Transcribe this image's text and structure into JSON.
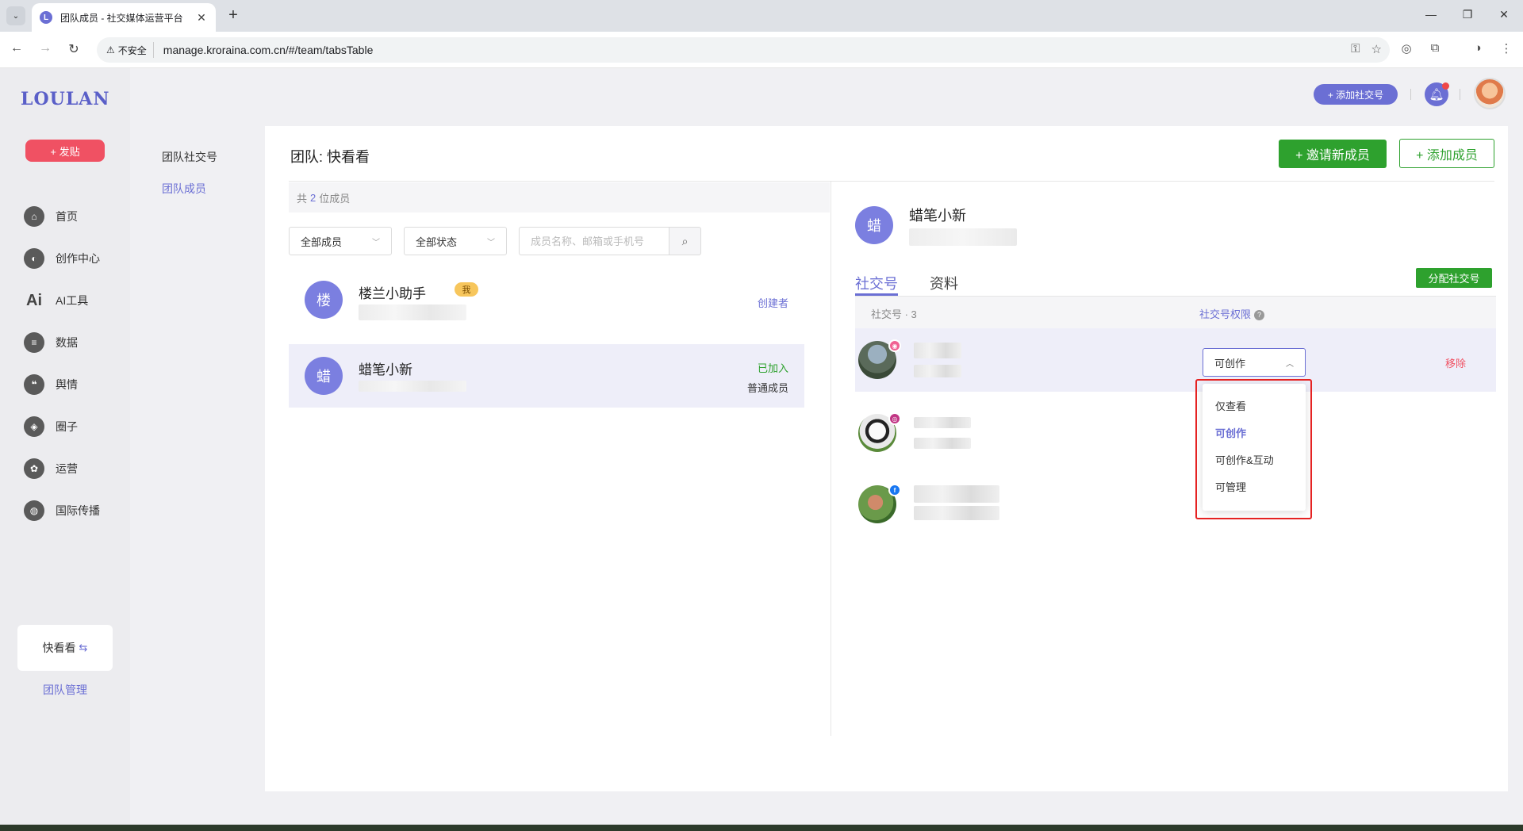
{
  "browser": {
    "tab_title": "团队成员 - 社交媒体运营平台",
    "tab_favicon_letter": "L",
    "url": "manage.kroraina.com.cn/#/team/tabsTable",
    "security_label": "不安全"
  },
  "sidebar": {
    "logo": "LOULAN",
    "post_button": "+ 发贴",
    "items": [
      {
        "label": "首页",
        "icon": "home-icon",
        "glyph": "⌂"
      },
      {
        "label": "创作中心",
        "icon": "palette-icon",
        "glyph": "◐"
      },
      {
        "label": "AI工具",
        "icon": "ai-icon",
        "glyph": "Ai"
      },
      {
        "label": "数据",
        "icon": "database-icon",
        "glyph": "≡"
      },
      {
        "label": "舆情",
        "icon": "quote-icon",
        "glyph": "❝"
      },
      {
        "label": "圈子",
        "icon": "compass-icon",
        "glyph": "◈"
      },
      {
        "label": "运营",
        "icon": "operations-icon",
        "glyph": "✿"
      },
      {
        "label": "国际传播",
        "icon": "globe-icon",
        "glyph": "◍"
      }
    ],
    "team_card": "快看看",
    "team_manage": "团队管理"
  },
  "subnav": {
    "social_accounts": "团队社交号",
    "members": "团队成员"
  },
  "topbar": {
    "add_social": "+ 添加社交号"
  },
  "main": {
    "title": "团队: 快看看",
    "invite_button": "+ 邀请新成员",
    "add_member_button": "+ 添加成员",
    "count_prefix": "共",
    "count": "2",
    "count_suffix": "位成员",
    "filter_members": "全部成员",
    "filter_status": "全部状态",
    "search_placeholder": "成员名称、邮箱或手机号",
    "members": [
      {
        "initial": "楼",
        "name": "楼兰小助手",
        "badge": "我",
        "role": "创建者",
        "status": ""
      },
      {
        "initial": "蜡",
        "name": "蜡笔小新",
        "badge": "",
        "role": "普通成员",
        "status": "已加入"
      }
    ]
  },
  "detail": {
    "initial": "蜡",
    "name": "蜡笔小新",
    "tab_social": "社交号",
    "tab_profile": "资料",
    "assign_button": "分配社交号",
    "col_accounts": "社交号 · 3",
    "col_permission": "社交号权限",
    "permission_value": "可创作",
    "remove_label": "移除",
    "accounts": [
      {
        "platform": "weibo",
        "platform_color": "#f06292"
      },
      {
        "platform": "instagram",
        "platform_color": "#c13584"
      },
      {
        "platform": "facebook",
        "platform_color": "#1877f2"
      }
    ],
    "permission_options": [
      "仅查看",
      "可创作",
      "可创作&互动",
      "可管理"
    ],
    "selected_option": "可创作"
  },
  "colors": {
    "accent": "#6b6fd4",
    "green": "#2ea12e",
    "danger": "#f05163"
  }
}
